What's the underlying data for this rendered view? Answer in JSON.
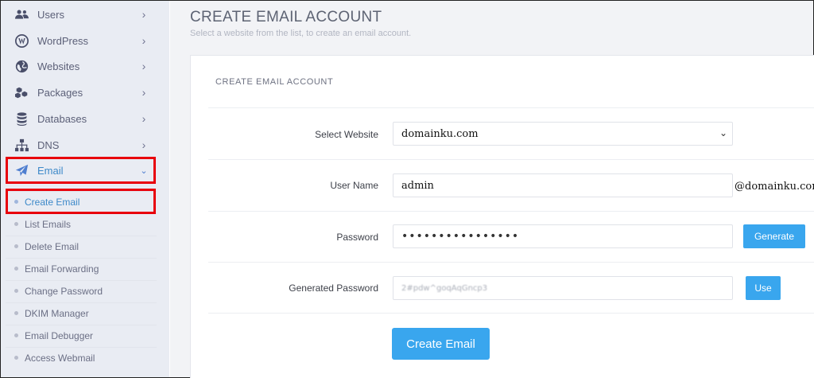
{
  "sidebar": {
    "items": [
      {
        "label": "Users",
        "icon": "users-icon"
      },
      {
        "label": "WordPress",
        "icon": "wordpress-icon"
      },
      {
        "label": "Websites",
        "icon": "globe-icon"
      },
      {
        "label": "Packages",
        "icon": "packages-icon"
      },
      {
        "label": "Databases",
        "icon": "database-icon"
      },
      {
        "label": "DNS",
        "icon": "sitemap-icon"
      },
      {
        "label": "Email",
        "icon": "paper-plane-icon"
      }
    ],
    "email_submenu": [
      "Create Email",
      "List Emails",
      "Delete Email",
      "Email Forwarding",
      "Change Password",
      "DKIM Manager",
      "Email Debugger",
      "Access Webmail"
    ]
  },
  "main": {
    "title": "CREATE EMAIL ACCOUNT",
    "subtitle": "Select a website from the list, to create an email account.",
    "card_title": "CREATE EMAIL ACCOUNT",
    "form": {
      "select_website_label": "Select Website",
      "select_website_value": "domainku.com",
      "username_label": "User Name",
      "username_value": "admin",
      "domain_suffix": "@domainku.com",
      "password_label": "Password",
      "password_value": "••••••••••••••••",
      "generate_button": "Generate",
      "generated_password_label": "Generated Password",
      "generated_password_value": "2#pdw^goqAqGncp3",
      "use_button": "Use",
      "submit_button": "Create Email"
    }
  },
  "colors": {
    "accent": "#39a6ee",
    "active_link": "#3d89c9",
    "highlight": "#e8000b",
    "sidebar_bg": "#e9ecf3"
  }
}
